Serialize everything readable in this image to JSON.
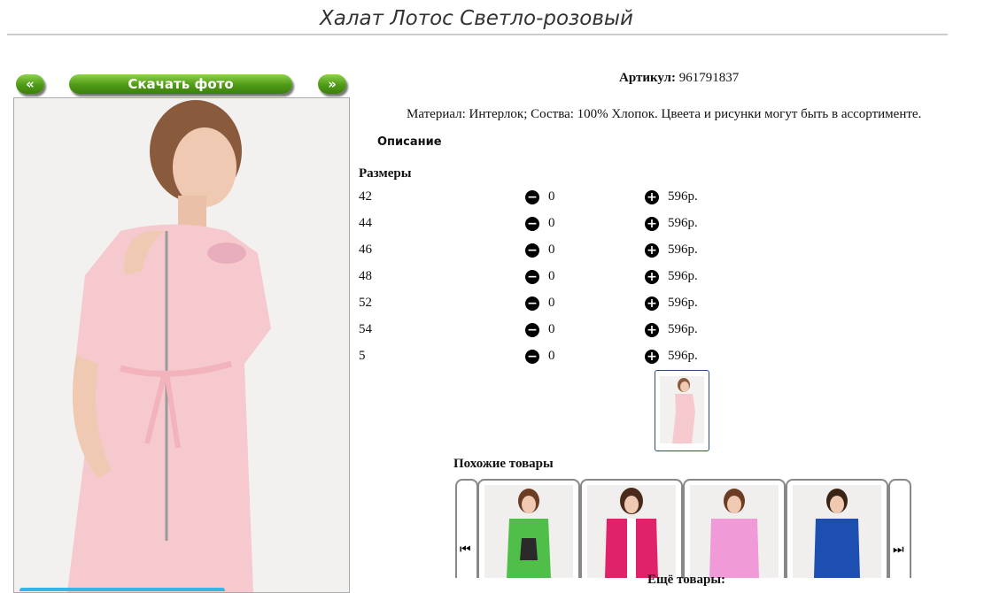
{
  "product": {
    "title": "Халат Лотос Светло-розовый",
    "article_label": "Артикул:",
    "article_value": "961791837",
    "description_text": "Материал: Интерлок; Соства: 100% Хлопок. Цвеета и рисунки могут быть в ассортименте.",
    "description_label": "Описание",
    "sizes_label": "Размеры"
  },
  "photo_nav": {
    "prev_label": "«",
    "download_label": "Скачать фото",
    "next_label": "»"
  },
  "sizes": [
    {
      "size": "42",
      "qty": "0",
      "price": "596р."
    },
    {
      "size": "44",
      "qty": "0",
      "price": "596р."
    },
    {
      "size": "46",
      "qty": "0",
      "price": "596р."
    },
    {
      "size": "48",
      "qty": "0",
      "price": "596р."
    },
    {
      "size": "52",
      "qty": "0",
      "price": "596р."
    },
    {
      "size": "54",
      "qty": "0",
      "price": "596р."
    },
    {
      "size": "5",
      "qty": "0",
      "price": "596р."
    }
  ],
  "similar": {
    "label": "Похожие товары",
    "more_label": "Ещё товары:",
    "items": [
      {
        "color": "#4fbf4a"
      },
      {
        "color": "#e0226a"
      },
      {
        "color": "#f19ad8"
      },
      {
        "color": "#1d4fb0"
      }
    ]
  },
  "icons": {
    "minus": "minus-circle-icon",
    "plus": "plus-circle-icon",
    "carousel_prev": "skip-back-icon",
    "carousel_next": "skip-forward-icon"
  },
  "colors": {
    "button_green": "#4f9a16",
    "dress_pink": "#f6c9cf",
    "thumb_border": "#2a4d7a"
  }
}
